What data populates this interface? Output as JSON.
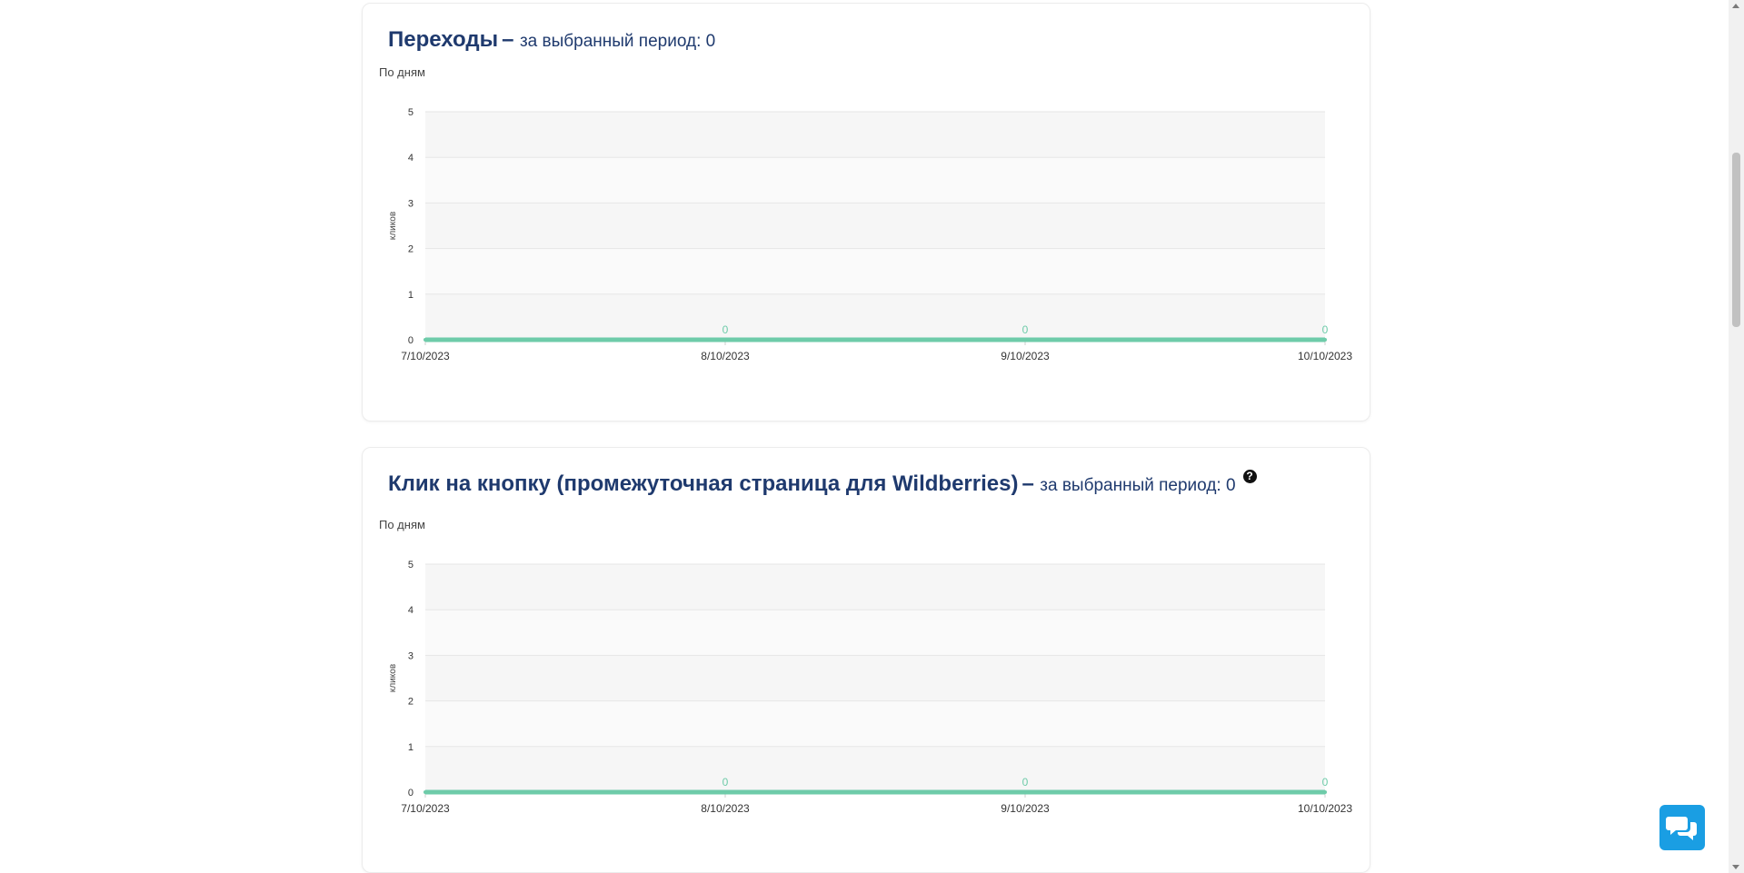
{
  "cards": [
    {
      "title": "Переходы",
      "title_sep": "–",
      "subtitle": "за выбранный период: 0",
      "per_day_label": "По дням",
      "help": false
    },
    {
      "title": "Клик на кнопку (промежуточная страница для Wildberries)",
      "title_sep": "–",
      "subtitle": "за выбранный период: 0",
      "per_day_label": "По дням",
      "help": true
    }
  ],
  "chart_data": [
    {
      "type": "line",
      "x": [
        "7/10/2023",
        "8/10/2023",
        "9/10/2023",
        "10/10/2023"
      ],
      "series": [
        {
          "values": [
            0,
            0,
            0,
            0
          ]
        }
      ],
      "data_labels": [
        "",
        "0",
        "0",
        "0"
      ],
      "ylabel": "кликов",
      "ylim": [
        0,
        5
      ],
      "yticks": [
        0,
        1,
        2,
        3,
        4,
        5
      ],
      "grid": true,
      "line_color": "#6ecba9"
    },
    {
      "type": "line",
      "x": [
        "7/10/2023",
        "8/10/2023",
        "9/10/2023",
        "10/10/2023"
      ],
      "series": [
        {
          "values": [
            0,
            0,
            0,
            0
          ]
        }
      ],
      "data_labels": [
        "",
        "0",
        "0",
        "0"
      ],
      "ylabel": "кликов",
      "ylim": [
        0,
        5
      ],
      "yticks": [
        0,
        1,
        2,
        3,
        4,
        5
      ],
      "grid": true,
      "line_color": "#6ecba9"
    }
  ],
  "help_icon": "question-circle-icon",
  "chat_icon": "chat-bubbles-icon",
  "colors": {
    "title": "#1f3a6e",
    "accent_line": "#6ecba9",
    "chat_button": "#1a9ee3"
  }
}
